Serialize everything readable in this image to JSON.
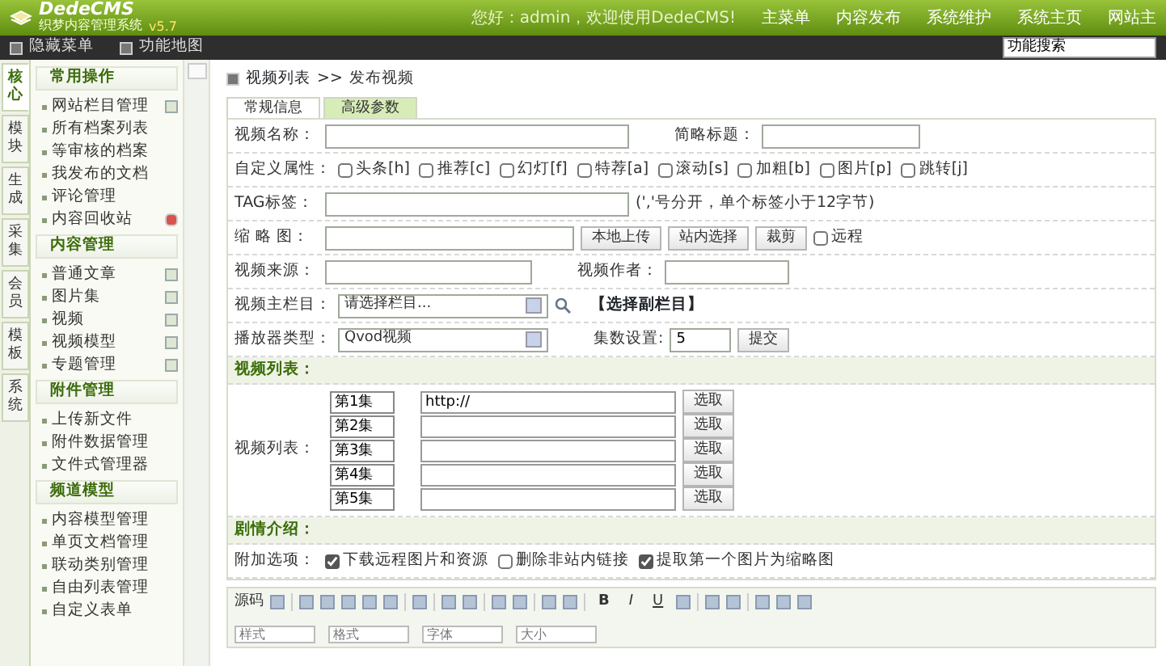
{
  "header": {
    "logo": "DedeCMS",
    "subtitle": "织梦内容管理系统",
    "version": "v5.7",
    "welcome": "您好：admin，欢迎使用DedeCMS!",
    "nav": [
      "主菜单",
      "内容发布",
      "系统维护",
      "系统主页",
      "网站主"
    ]
  },
  "subbar": {
    "links": [
      "隐藏菜单",
      "功能地图"
    ],
    "search": {
      "value": "功能搜索"
    }
  },
  "side_tabs": [
    {
      "label": "核心",
      "selected": true
    },
    {
      "label": "模块",
      "selected": false
    },
    {
      "label": "生成",
      "selected": false
    },
    {
      "label": "采集",
      "selected": false
    },
    {
      "label": "会员",
      "selected": false
    },
    {
      "label": "模板",
      "selected": false
    },
    {
      "label": "系统",
      "selected": false
    }
  ],
  "sidebar": [
    {
      "title": "常用操作",
      "items": [
        {
          "label": "网站栏目管理",
          "kind": "add"
        },
        {
          "label": "所有档案列表",
          "kind": "plain"
        },
        {
          "label": "等审核的档案",
          "kind": "plain"
        },
        {
          "label": "我发布的文档",
          "kind": "plain"
        },
        {
          "label": "评论管理",
          "kind": "plain"
        },
        {
          "label": "内容回收站",
          "kind": "trash"
        }
      ]
    },
    {
      "title": "内容管理",
      "items": [
        {
          "label": "普通文章",
          "kind": "add"
        },
        {
          "label": "图片集",
          "kind": "add"
        },
        {
          "label": "视频",
          "kind": "add"
        },
        {
          "label": "视频模型",
          "kind": "add"
        },
        {
          "label": "专题管理",
          "kind": "add"
        }
      ]
    },
    {
      "title": "附件管理",
      "items": [
        {
          "label": "上传新文件",
          "kind": "plain"
        },
        {
          "label": "附件数据管理",
          "kind": "plain"
        },
        {
          "label": "文件式管理器",
          "kind": "plain"
        }
      ]
    },
    {
      "title": "频道模型",
      "items": [
        {
          "label": "内容模型管理",
          "kind": "plain"
        },
        {
          "label": "单页文档管理",
          "kind": "plain"
        },
        {
          "label": "联动类别管理",
          "kind": "plain"
        },
        {
          "label": "自由列表管理",
          "kind": "plain"
        },
        {
          "label": "自定义表单",
          "kind": "plain"
        }
      ]
    }
  ],
  "breadcrumb": {
    "parent": "视频列表",
    "separator": ">>",
    "current": "发布视频"
  },
  "tabs": [
    {
      "label": "常规信息",
      "selected": true
    },
    {
      "label": "高级参数",
      "selected": false
    }
  ],
  "form_rows": [
    {
      "kind": "fields",
      "parts": [
        {
          "kind": "label",
          "text": "视频名称："
        },
        {
          "kind": "input"
        },
        {
          "kind": "label",
          "text": "简略标题："
        },
        {
          "kind": "input"
        }
      ]
    },
    {
      "kind": "fields",
      "parts": [
        {
          "kind": "label",
          "text": "自定义属性："
        },
        {
          "kind": "checks",
          "items": [
            {
              "label": "头条[h]",
              "checked": false
            },
            {
              "label": "推荐[c]",
              "checked": false
            },
            {
              "label": "幻灯[f]",
              "checked": false
            },
            {
              "label": "特荐[a]",
              "checked": false
            },
            {
              "label": "滚动[s]",
              "checked": false
            },
            {
              "label": "加粗[b]",
              "checked": false
            },
            {
              "label": "图片[p]",
              "checked": false
            },
            {
              "label": "跳转[j]",
              "checked": false
            }
          ]
        }
      ]
    },
    {
      "kind": "fields",
      "parts": [
        {
          "kind": "label",
          "text": "TAG标签："
        },
        {
          "kind": "input"
        },
        {
          "kind": "note",
          "text": "(','号分开，单个标签小于12字节)"
        }
      ]
    },
    {
      "kind": "fields",
      "parts": [
        {
          "kind": "label",
          "text": "缩 略 图："
        },
        {
          "kind": "input"
        },
        {
          "kind": "button",
          "text": "本地上传"
        },
        {
          "kind": "button",
          "text": "站内选择"
        },
        {
          "kind": "button",
          "text": "裁剪"
        },
        {
          "kind": "check",
          "label": "远程",
          "checked": false
        }
      ]
    },
    {
      "kind": "fields",
      "parts": [
        {
          "kind": "label",
          "text": "视频来源："
        },
        {
          "kind": "input"
        },
        {
          "kind": "label",
          "text": "视频作者："
        },
        {
          "kind": "input"
        }
      ]
    },
    {
      "kind": "fields",
      "parts": [
        {
          "kind": "label",
          "text": "视频主栏目："
        },
        {
          "kind": "select",
          "value": "请选择栏目..."
        },
        {
          "kind": "search"
        },
        {
          "kind": "link",
          "text": "【选择副栏目】"
        }
      ]
    },
    {
      "kind": "fields",
      "parts": [
        {
          "kind": "label",
          "text": "播放器类型："
        },
        {
          "kind": "select",
          "value": "Qvod视频"
        },
        {
          "kind": "label",
          "text": "集数设置:"
        },
        {
          "kind": "input",
          "value": "5"
        },
        {
          "kind": "button",
          "text": "提交"
        }
      ]
    },
    {
      "kind": "section",
      "text": "视频列表："
    },
    {
      "kind": "episodes",
      "label": "视频列表：",
      "episodes": [
        {
          "name": "第1集",
          "url": "http://",
          "button": "选取"
        },
        {
          "name": "第2集",
          "button": "选取"
        },
        {
          "name": "第3集",
          "button": "选取"
        },
        {
          "name": "第4集",
          "button": "选取"
        },
        {
          "name": "第5集",
          "button": "选取"
        }
      ]
    },
    {
      "kind": "section",
      "text": "剧情介绍："
    },
    {
      "kind": "fields",
      "parts": [
        {
          "kind": "label",
          "text": "附加选项："
        },
        {
          "kind": "check",
          "label": "下载远程图片和资源",
          "checked": true
        },
        {
          "kind": "check",
          "label": "删除非站内链接",
          "checked": false
        },
        {
          "kind": "check",
          "label": "提取第一个图片为缩略图",
          "checked": true
        }
      ]
    }
  ],
  "editor": {
    "toolbar": [
      {
        "kind": "text",
        "label": "源码"
      },
      {
        "kind": "icon"
      },
      {
        "kind": "sep"
      },
      {
        "kind": "icon"
      },
      {
        "kind": "icon"
      },
      {
        "kind": "icon"
      },
      {
        "kind": "icon"
      },
      {
        "kind": "icon"
      },
      {
        "kind": "sep"
      },
      {
        "kind": "icon"
      },
      {
        "kind": "sep"
      },
      {
        "kind": "icon"
      },
      {
        "kind": "icon"
      },
      {
        "kind": "sep"
      },
      {
        "kind": "icon"
      },
      {
        "kind": "icon"
      },
      {
        "kind": "sep"
      },
      {
        "kind": "icon"
      },
      {
        "kind": "icon"
      },
      {
        "kind": "sep"
      },
      {
        "kind": "bold",
        "label": "B"
      },
      {
        "kind": "italic",
        "label": "I"
      },
      {
        "kind": "underline",
        "label": "U"
      },
      {
        "kind": "icon"
      },
      {
        "kind": "sep"
      },
      {
        "kind": "icon"
      },
      {
        "kind": "icon"
      },
      {
        "kind": "sep"
      },
      {
        "kind": "icon"
      },
      {
        "kind": "icon"
      },
      {
        "kind": "icon"
      }
    ],
    "dropdowns": [
      "样式",
      "格式",
      "字体",
      "大小"
    ]
  }
}
